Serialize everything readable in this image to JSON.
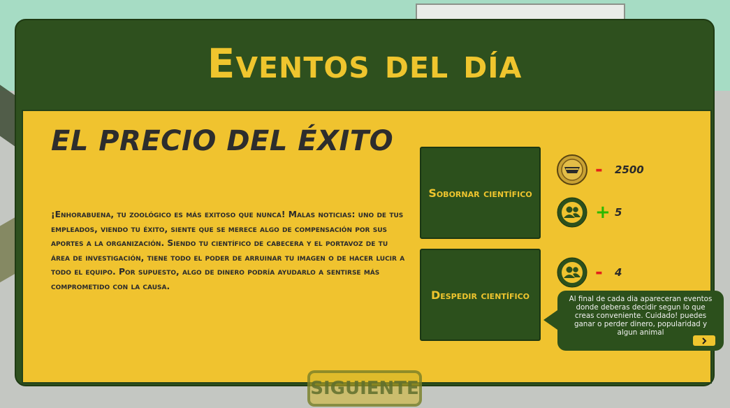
{
  "screen": {
    "title": "Eventos del día",
    "next_label": "SIGUIENTE"
  },
  "event": {
    "title": "EL PRECIO DEL ÉXITO",
    "description": " ¡Enhorabuena, tu zoológico es más exitoso que nunca! Malas noticias: uno de tus empleados, viendo tu éxito, siente que se merece algo de compensación por sus aportes a la organización. Siendo tu científico de cabecera y el portavoz de tu área de investigación, tiene todo el poder de arruinar tu imagen o de hacer lucir a todo el equipo. Por supuesto, algo de dinero podría ayudarlo a sentirse más comprometido con la causa."
  },
  "options": [
    {
      "label": "Sobornar científico",
      "effects": [
        {
          "icon": "coin-icon",
          "sign": "-",
          "value": "2500"
        },
        {
          "icon": "staff-icon",
          "sign": "+",
          "value": "5"
        }
      ]
    },
    {
      "label": "Despedir científico",
      "effects": [
        {
          "icon": "staff-icon",
          "sign": "-",
          "value": "4"
        }
      ]
    }
  ],
  "tooltip": {
    "text": "Al  final de cada dia apareceran eventos donde deberas decidir segun lo que creas conveniente. Cuidado! puedes ganar o perder dinero, popularidad y algun animal",
    "next_icon": "chevron-right-icon"
  },
  "colors": {
    "panel_green": "#2e501e",
    "content_yellow": "#f0c32f",
    "title_yellow": "#efc52e",
    "minus_red": "#e3201a",
    "plus_green": "#2bb800"
  }
}
